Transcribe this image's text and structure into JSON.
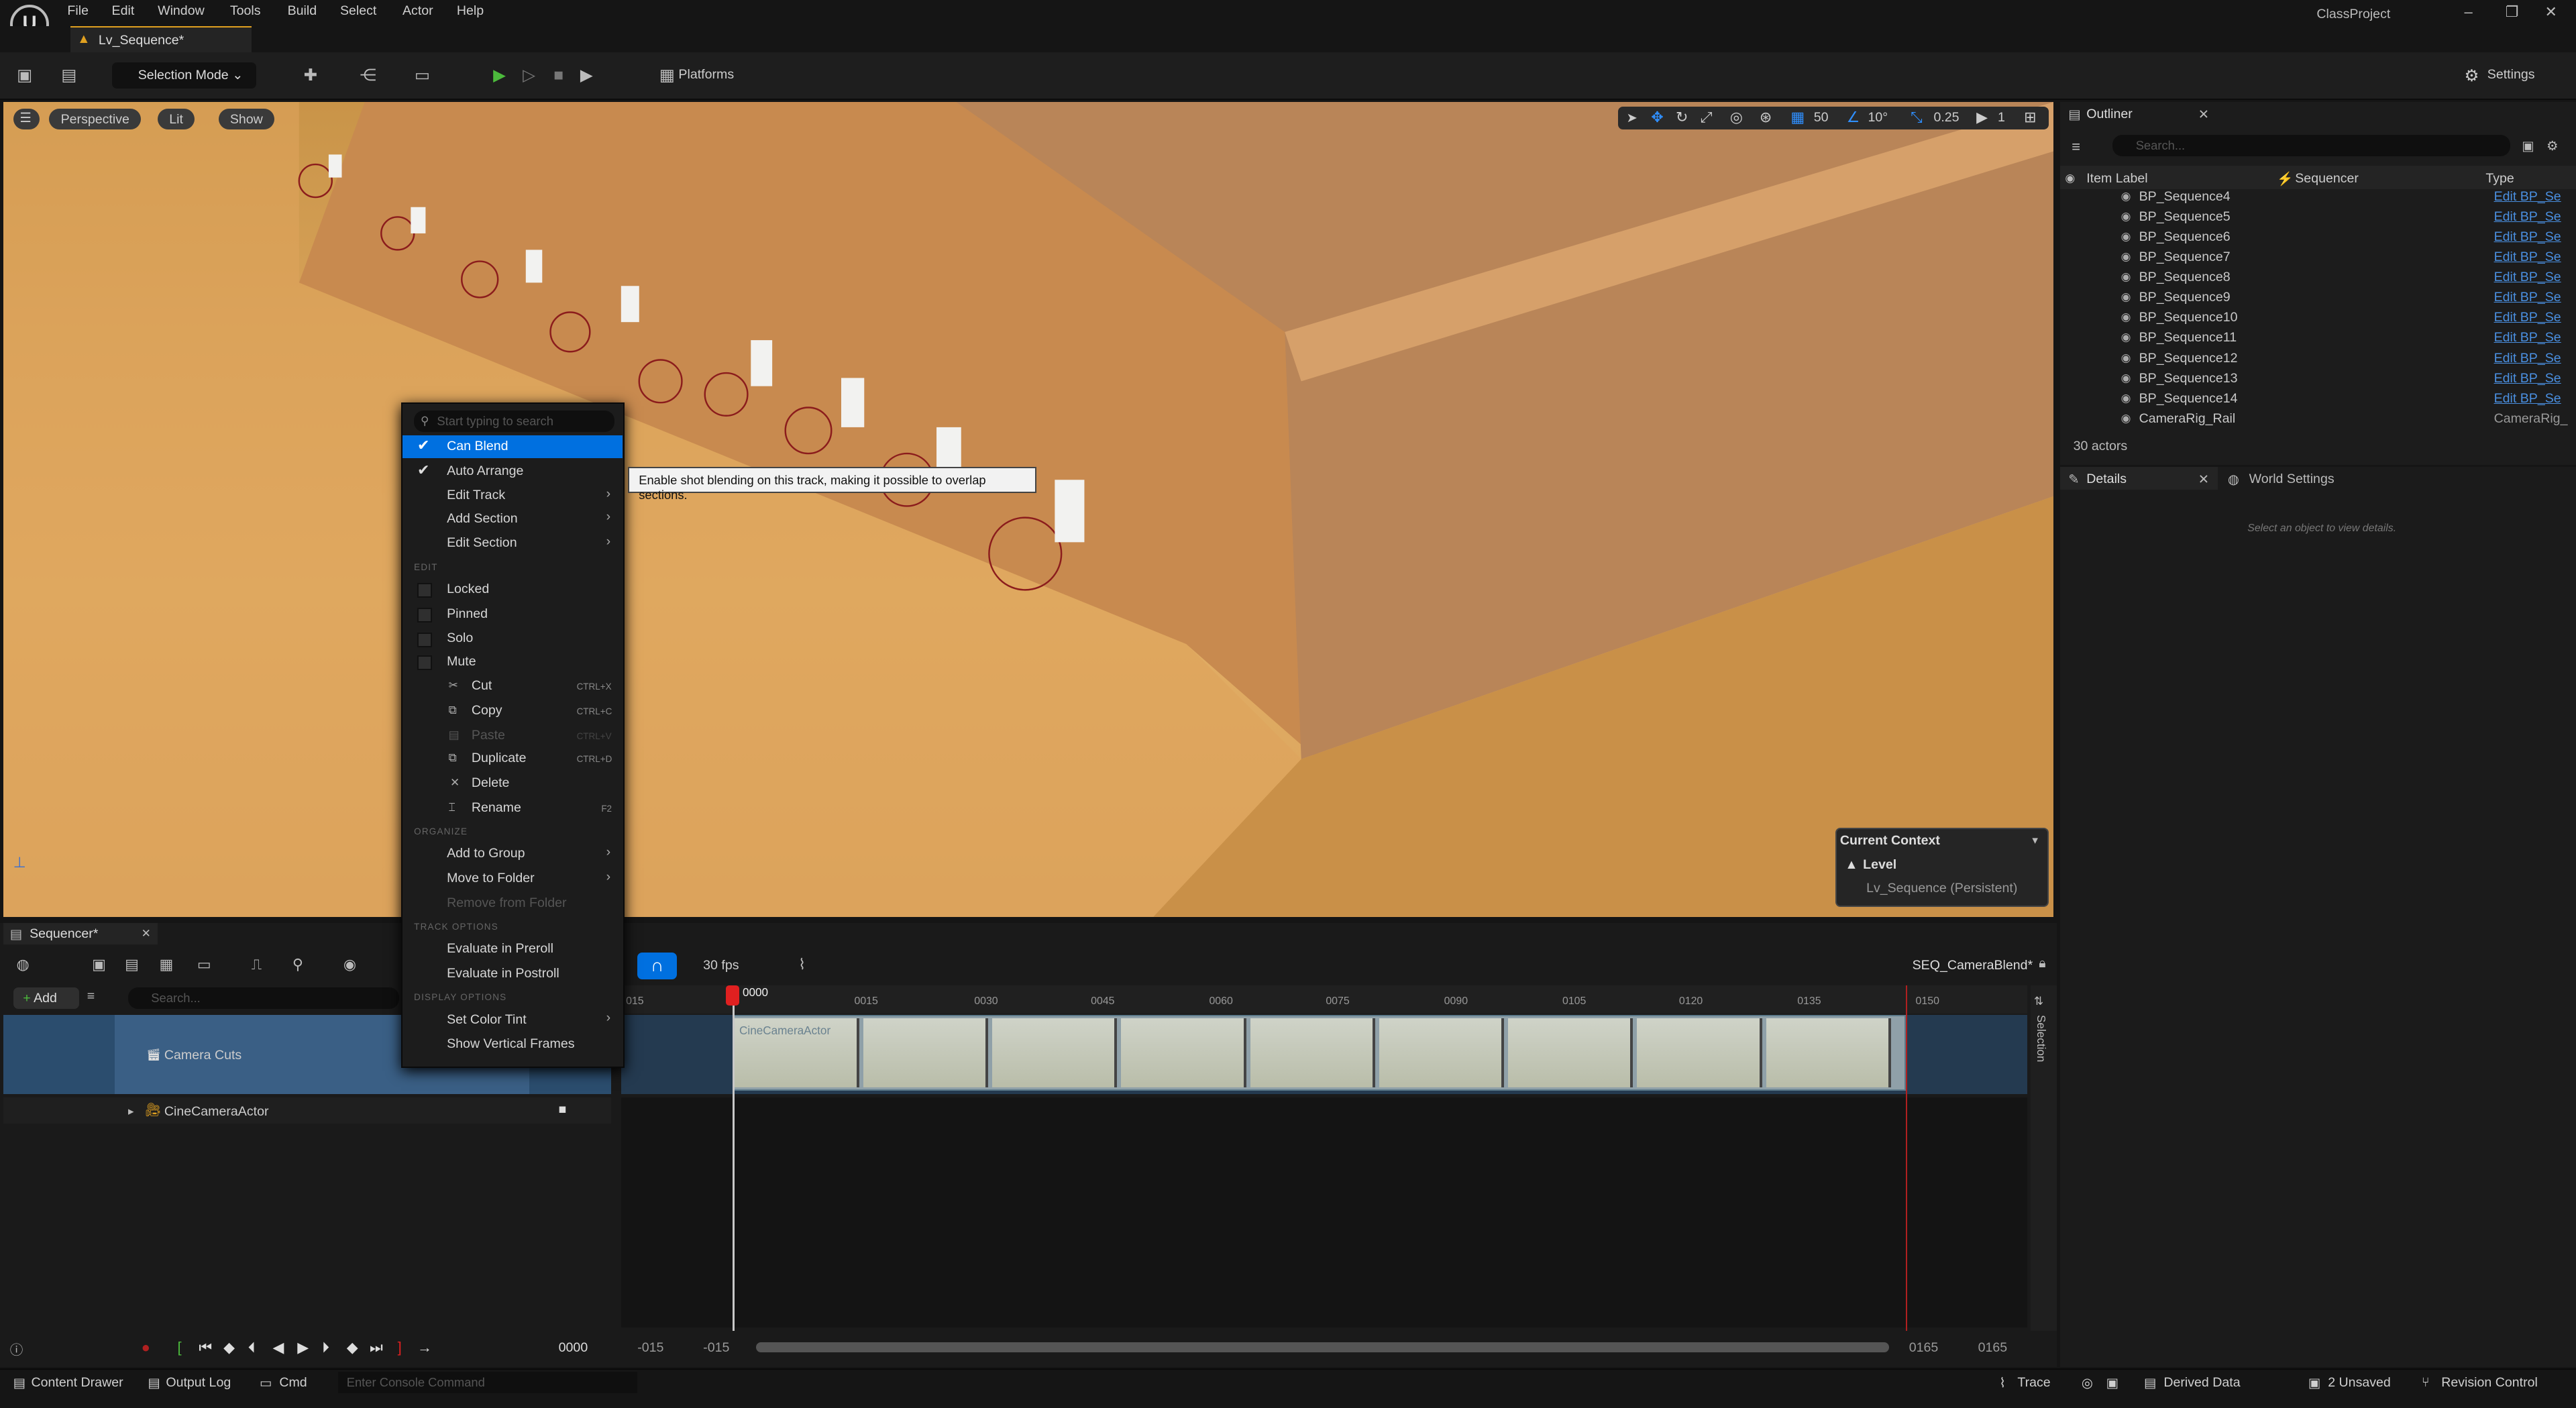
{
  "app": {
    "project": "ClassProject",
    "tab": "Lv_Sequence*"
  },
  "menu": [
    "File",
    "Edit",
    "Window",
    "Tools",
    "Build",
    "Select",
    "Actor",
    "Help"
  ],
  "toolbar": {
    "selection_mode": "Selection Mode",
    "platforms": "Platforms",
    "settings": "Settings"
  },
  "viewport": {
    "perspective": "Perspective",
    "lit": "Lit",
    "show": "Show",
    "grid": "50",
    "angle": "10°",
    "scale": "0.25",
    "cam": "1"
  },
  "context_menu": {
    "search_placeholder": "Start typing to search",
    "can_blend": "Can Blend",
    "auto_arrange": "Auto Arrange",
    "edit_track": "Edit Track",
    "add_section": "Add Section",
    "edit_section": "Edit Section",
    "sec_edit": "EDIT",
    "locked": "Locked",
    "pinned": "Pinned",
    "solo": "Solo",
    "mute": "Mute",
    "cut": "Cut",
    "cut_sc": "CTRL+X",
    "copy": "Copy",
    "copy_sc": "CTRL+C",
    "paste": "Paste",
    "paste_sc": "CTRL+V",
    "duplicate": "Duplicate",
    "duplicate_sc": "CTRL+D",
    "delete": "Delete",
    "rename": "Rename",
    "rename_sc": "F2",
    "sec_organize": "ORGANIZE",
    "add_to_group": "Add to Group",
    "move_to_folder": "Move to Folder",
    "remove_from_folder": "Remove from Folder",
    "sec_track_options": "TRACK OPTIONS",
    "eval_preroll": "Evaluate in Preroll",
    "eval_postroll": "Evaluate in Postroll",
    "sec_display": "DISPLAY OPTIONS",
    "set_color_tint": "Set Color Tint",
    "show_vertical_frames": "Show Vertical Frames"
  },
  "tooltip": "Enable shot blending on this track, making it possible to overlap sections.",
  "current_context": {
    "title": "Current Context",
    "level": "Level",
    "value": "Lv_Sequence (Persistent)"
  },
  "outliner": {
    "title": "Outliner",
    "search": "Search...",
    "col_label": "Item Label",
    "col_seq": "Sequencer",
    "col_type": "Type",
    "rows": [
      "BP_Sequence4",
      "BP_Sequence5",
      "BP_Sequence6",
      "BP_Sequence7",
      "BP_Sequence8",
      "BP_Sequence9",
      "BP_Sequence10",
      "BP_Sequence11",
      "BP_Sequence12",
      "BP_Sequence13",
      "BP_Sequence14",
      "CameraRig_Rail"
    ],
    "type_link": "Edit BP_Se",
    "last_type": "CameraRig_",
    "count": "30 actors"
  },
  "details": {
    "title": "Details",
    "world": "World Settings",
    "empty": "Select an object to view details."
  },
  "sequencer": {
    "title": "Sequencer*",
    "add": "Add",
    "search": "Search...",
    "fps": "30 fps",
    "seq_name": "SEQ_CameraBlend*",
    "track1": "Camera Cuts",
    "track2": "CineCameraActor",
    "clip": "CineCameraActor",
    "selection": "Selection",
    "ruler": [
      "015",
      "0015",
      "0030",
      "0045",
      "0060",
      "0075",
      "0090",
      "0105",
      "0120",
      "0135",
      "0150"
    ],
    "playhead": "0000",
    "time": "0000",
    "range": [
      "-015",
      "-015",
      "0165",
      "0165"
    ]
  },
  "statusbar": {
    "content": "Content Drawer",
    "output": "Output Log",
    "cmd": "Cmd",
    "console": "Enter Console Command",
    "trace": "Trace",
    "derived": "Derived Data",
    "unsaved": "2 Unsaved",
    "revision": "Revision Control"
  }
}
